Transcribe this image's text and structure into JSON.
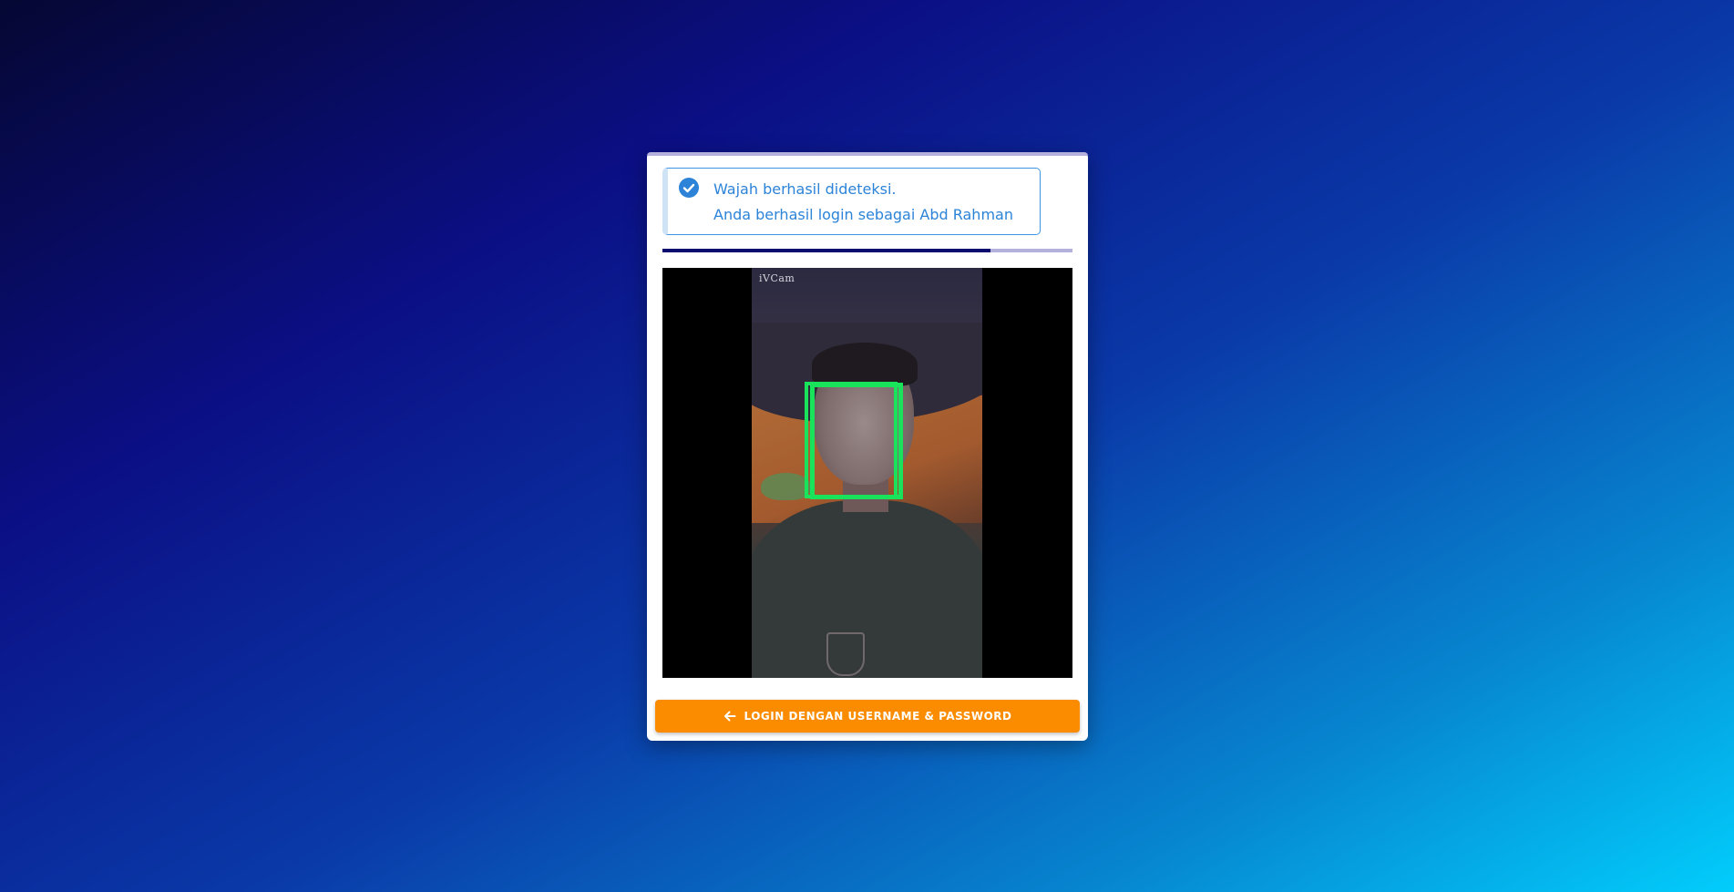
{
  "alert": {
    "icon": "check-circle-icon",
    "line1": "Wajah berhasil dideteksi.",
    "line2": "Anda berhasil login sebagai Abd Rahman",
    "color": "#2c83d8"
  },
  "progress": {
    "value_percent": 80,
    "fill_color": "#0c0a6e",
    "track_color": "#b3b0dc"
  },
  "camera": {
    "overlay_label": "iVCam",
    "detection_box_color": "#19e35a"
  },
  "login_button": {
    "icon": "arrow-left-icon",
    "label": "LOGIN DENGAN USERNAME & PASSWORD",
    "color": "#fb8c00"
  }
}
